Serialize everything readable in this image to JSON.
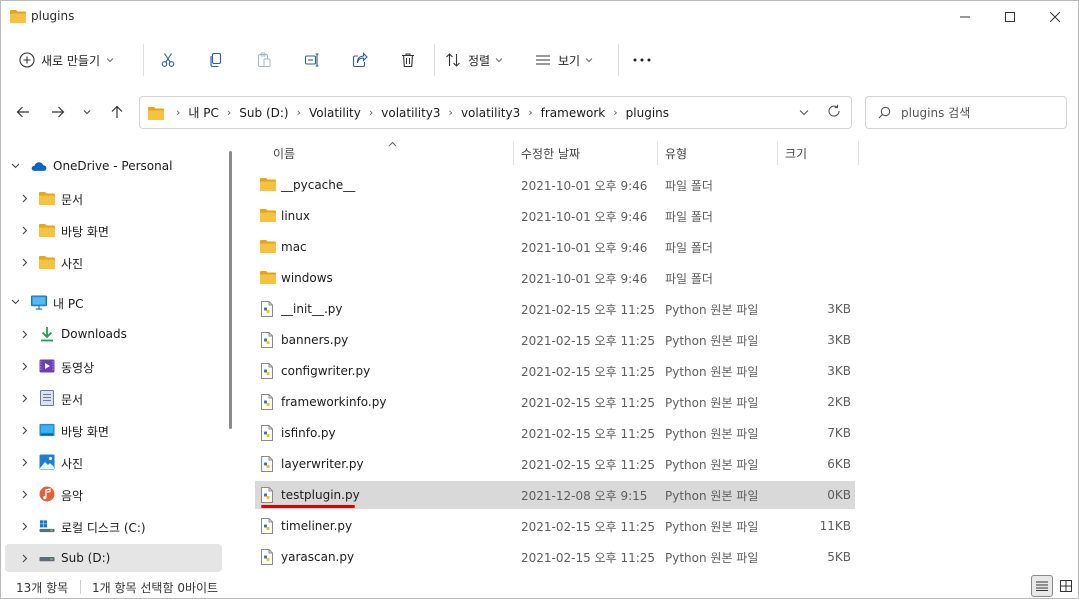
{
  "window": {
    "title": "plugins"
  },
  "toolbar": {
    "new_label": "새로 만들기",
    "sort_label": "정렬",
    "view_label": "보기"
  },
  "address": {
    "crumbs": [
      "내 PC",
      "Sub (D:)",
      "Volatility",
      "volatility3",
      "volatility3",
      "framework",
      "plugins"
    ]
  },
  "search": {
    "placeholder": "plugins 검색"
  },
  "sidebar": {
    "items": [
      {
        "label": "OneDrive - Personal",
        "icon": "onedrive-icon"
      },
      {
        "label": "문서",
        "icon": "folder-icon"
      },
      {
        "label": "바탕 화면",
        "icon": "folder-icon"
      },
      {
        "label": "사진",
        "icon": "folder-icon"
      },
      {
        "label": "내 PC",
        "icon": "pc-icon"
      },
      {
        "label": "Downloads",
        "icon": "download-icon"
      },
      {
        "label": "동영상",
        "icon": "videos-icon"
      },
      {
        "label": "문서",
        "icon": "documents-icon"
      },
      {
        "label": "바탕 화면",
        "icon": "desktop-icon"
      },
      {
        "label": "사진",
        "icon": "pictures-icon"
      },
      {
        "label": "음악",
        "icon": "music-icon"
      },
      {
        "label": "로컬 디스크 (C:)",
        "icon": "windows-drive-icon"
      },
      {
        "label": "Sub (D:)",
        "icon": "drive-icon"
      }
    ]
  },
  "columns": {
    "name": "이름",
    "date": "수정한 날짜",
    "type": "유형",
    "size": "크기"
  },
  "files": [
    {
      "name": "__pycache__",
      "date": "2021-10-01 오후 9:46",
      "type": "파일 폴더",
      "size": "",
      "kind": "folder"
    },
    {
      "name": "linux",
      "date": "2021-10-01 오후 9:46",
      "type": "파일 폴더",
      "size": "",
      "kind": "folder"
    },
    {
      "name": "mac",
      "date": "2021-10-01 오후 9:46",
      "type": "파일 폴더",
      "size": "",
      "kind": "folder"
    },
    {
      "name": "windows",
      "date": "2021-10-01 오후 9:46",
      "type": "파일 폴더",
      "size": "",
      "kind": "folder"
    },
    {
      "name": "__init__.py",
      "date": "2021-02-15 오후 11:25",
      "type": "Python 원본 파일",
      "size": "3KB",
      "kind": "py"
    },
    {
      "name": "banners.py",
      "date": "2021-02-15 오후 11:25",
      "type": "Python 원본 파일",
      "size": "3KB",
      "kind": "py"
    },
    {
      "name": "configwriter.py",
      "date": "2021-02-15 오후 11:25",
      "type": "Python 원본 파일",
      "size": "3KB",
      "kind": "py"
    },
    {
      "name": "frameworkinfo.py",
      "date": "2021-02-15 오후 11:25",
      "type": "Python 원본 파일",
      "size": "2KB",
      "kind": "py"
    },
    {
      "name": "isfinfo.py",
      "date": "2021-02-15 오후 11:25",
      "type": "Python 원본 파일",
      "size": "7KB",
      "kind": "py"
    },
    {
      "name": "layerwriter.py",
      "date": "2021-02-15 오후 11:25",
      "type": "Python 원본 파일",
      "size": "6KB",
      "kind": "py"
    },
    {
      "name": "testplugin.py",
      "date": "2021-12-08 오후 9:15",
      "type": "Python 원본 파일",
      "size": "0KB",
      "kind": "py"
    },
    {
      "name": "timeliner.py",
      "date": "2021-02-15 오후 11:25",
      "type": "Python 원본 파일",
      "size": "11KB",
      "kind": "py"
    },
    {
      "name": "yarascan.py",
      "date": "2021-02-15 오후 11:25",
      "type": "Python 원본 파일",
      "size": "5KB",
      "kind": "py"
    }
  ],
  "status": {
    "count": "13개 항목",
    "selection": "1개 항목 선택함 0바이트"
  },
  "colors": {
    "folder": "#f5c242",
    "accent": "#0067c0",
    "selection": "#d9d9d9",
    "underline": "#e00000"
  }
}
